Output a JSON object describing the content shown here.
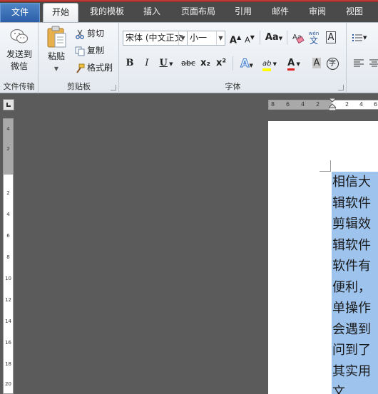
{
  "tabs": [
    {
      "label": "文件"
    },
    {
      "label": "开始"
    },
    {
      "label": "我的模板"
    },
    {
      "label": "插入"
    },
    {
      "label": "页面布局"
    },
    {
      "label": "引用"
    },
    {
      "label": "邮件"
    },
    {
      "label": "审阅"
    },
    {
      "label": "视图"
    }
  ],
  "groups": {
    "file_transfer": {
      "label": "文件传输",
      "send_to_wechat": "发送到\n微信",
      "send_line1": "发送到",
      "send_line2": "微信"
    },
    "clipboard": {
      "label": "剪贴板",
      "paste": "粘贴",
      "cut": "剪切",
      "copy": "复制",
      "format_painter": "格式刷"
    },
    "font": {
      "label": "字体",
      "font_name": "宋体 (中文正文",
      "font_size": "小一",
      "bold": "B",
      "italic": "I",
      "underline": "U",
      "strikethrough": "abc",
      "subscript": "x₂",
      "superscript": "x²",
      "change_case": "Aa",
      "grow": "A",
      "shrink": "A",
      "clear_format": "A",
      "phonetic": "wén",
      "char_border": "A",
      "text_effect": "A",
      "highlight": "ab",
      "font_color": "A",
      "char_shading": "A",
      "enclose": "字"
    }
  },
  "ruler": {
    "h_numbers": [
      "8",
      "6",
      "4",
      "2",
      "2",
      "4",
      "6"
    ],
    "v_numbers": [
      "4",
      "2",
      "2",
      "4",
      "6",
      "8",
      "10",
      "12",
      "14",
      "16",
      "18",
      "20"
    ]
  },
  "document": {
    "lines": [
      "相信大",
      "辑软件",
      "剪辑效",
      "辑软件",
      "软件有",
      "便利，",
      "单操作",
      "会遇到",
      "问到了",
      "其实用",
      "文"
    ]
  },
  "colors": {
    "selection": "#9ec4ee",
    "file_tab": "#2b5ea8",
    "highlight_yellow": "#ffff00",
    "font_color_red": "#e02020"
  }
}
